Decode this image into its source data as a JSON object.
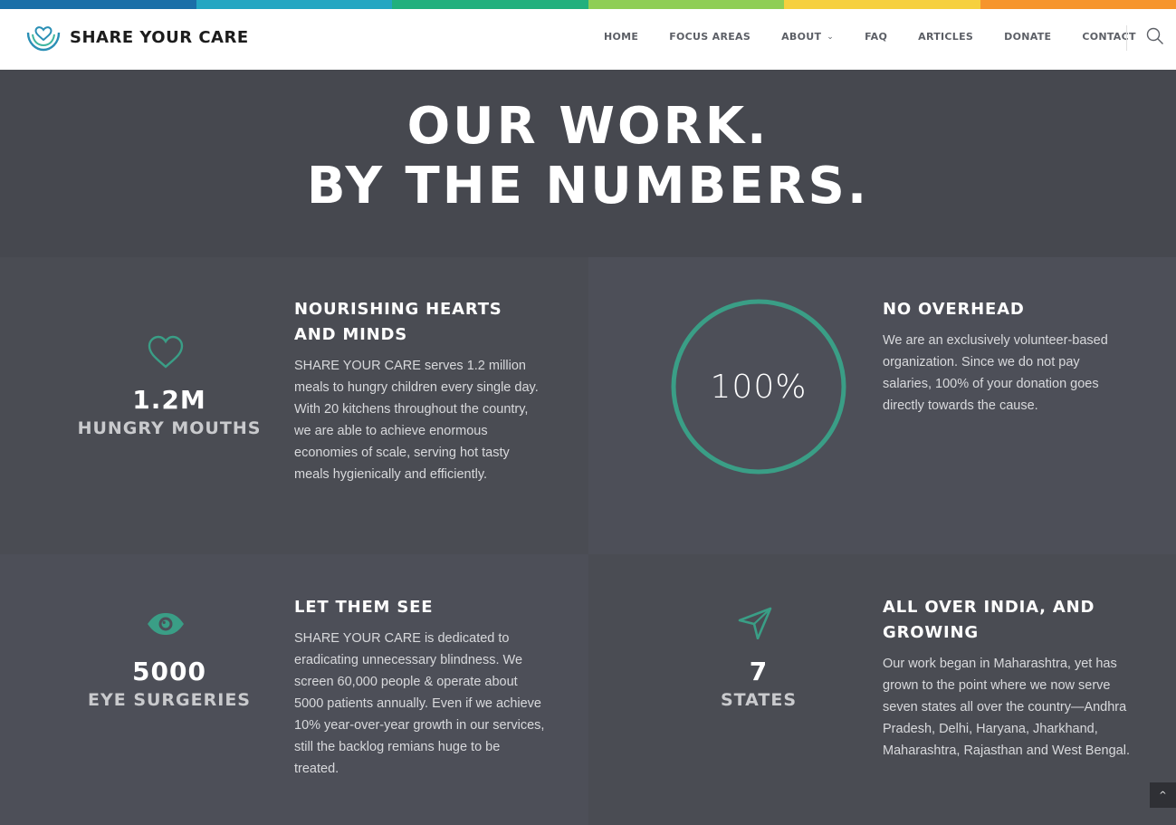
{
  "colors": {
    "strip": [
      "#1a6fa8",
      "#23a6c2",
      "#21b07d",
      "#8fce55",
      "#f6d03e",
      "#f6952c"
    ],
    "accent": "#3a9e86",
    "nav_text": "#5c5f66"
  },
  "brand": {
    "name": "SHARE YOUR CARE",
    "logo_icon": "hands-heart-icon"
  },
  "nav": {
    "items": [
      {
        "label": "HOME"
      },
      {
        "label": "FOCUS AREAS"
      },
      {
        "label": "ABOUT"
      },
      {
        "label": "FAQ"
      },
      {
        "label": "ARTICLES"
      },
      {
        "label": "DONATE"
      },
      {
        "label": "CONTACT"
      }
    ],
    "search_icon": "search-icon"
  },
  "hero": {
    "line1": "OUR WORK.",
    "line2": "BY THE NUMBERS."
  },
  "blocks": [
    {
      "icon": "heart-icon",
      "stat_number": "1.2M",
      "stat_label": "HUNGRY MOUTHS",
      "title": "NOURISHING HEARTS AND MINDS",
      "body": "SHARE YOUR CARE serves 1.2 million meals to hungry children every single day. With 20 kitchens throughout the country, we are able to achieve enormous economies of scale, serving hot tasty meals hygienically and efficiently."
    },
    {
      "icon": "progress-ring",
      "ring_percent": "100%",
      "ring_fraction": 1.0,
      "title": "NO OVERHEAD",
      "body": "We are an exclusively volunteer-based organization. Since we do not pay salaries, 100% of your donation goes directly towards the cause."
    },
    {
      "icon": "eye-icon",
      "stat_number": "5000",
      "stat_label": "EYE SURGERIES",
      "title": "LET THEM SEE",
      "body": "SHARE YOUR CARE is dedicated to eradicating unnecessary blindness. We screen 60,000 people & operate about 5000 patients annually. Even if we achieve 10% year-over-year growth in our services, still the backlog remians huge to be treated."
    },
    {
      "icon": "navigation-arrow-icon",
      "stat_number": "7",
      "stat_label": "STATES",
      "title": "ALL OVER INDIA, AND GROWING",
      "body": "Our work began in Maharashtra, yet has grown to the point where we now serve seven states all over the country—Andhra Pradesh, Delhi, Haryana, Jharkhand, Maharashtra, Rajasthan and West Bengal."
    }
  ],
  "scroll_top_icon": "chevron-up-icon"
}
